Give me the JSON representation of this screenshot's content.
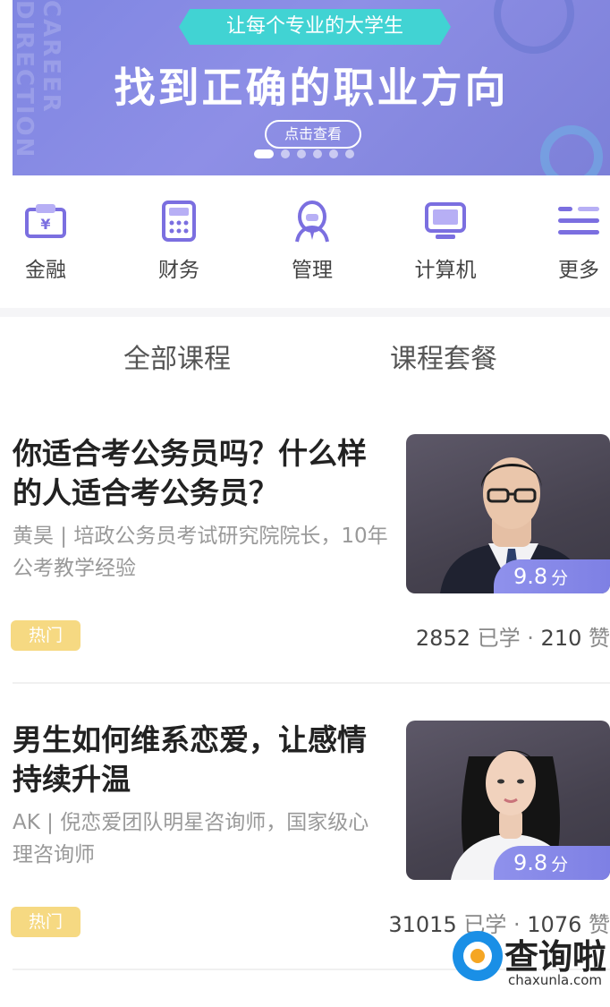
{
  "banner": {
    "ribbon_text": "让每个专业的大学生",
    "headline": "找到正确的职业方向",
    "cta_label": "点击查看",
    "deco_text": "CAREER DIRECTION",
    "slides_total": 6,
    "active_slide": 1
  },
  "categories": [
    {
      "label": "金融",
      "icon": "money-wallet-icon"
    },
    {
      "label": "财务",
      "icon": "calculator-icon"
    },
    {
      "label": "管理",
      "icon": "manager-person-icon"
    },
    {
      "label": "计算机",
      "icon": "computer-monitor-icon"
    },
    {
      "label": "更多",
      "icon": "menu-lines-icon"
    }
  ],
  "tabs": [
    {
      "label": "全部课程"
    },
    {
      "label": "课程套餐"
    }
  ],
  "courses": [
    {
      "title": "你适合考公务员吗？什么样的人适合考公务员？",
      "desc": "黄昊 | 培政公务员考试研究院院长，10年公考教学经验",
      "badge": "热门",
      "score": "9.8",
      "score_unit": "分",
      "learners": "2852",
      "learners_label": "已学",
      "likes": "210",
      "likes_label": "赞"
    },
    {
      "title": "男生如何维系恋爱，让感情持续升温",
      "desc": "AK | 倪恋爱团队明星咨询师，国家级心理咨询师",
      "badge": "热门",
      "score": "9.8",
      "score_unit": "分",
      "learners": "31015",
      "learners_label": "已学",
      "likes": "1076",
      "likes_label": "赞"
    }
  ],
  "watermark": {
    "name": "查询啦",
    "domain": "chaxunla.com"
  },
  "colors": {
    "banner_bg": "#8e8fe6",
    "accent_purple": "#7e80e4",
    "badge_yellow": "#f6d982",
    "ribbon_teal": "#41d3d3"
  }
}
